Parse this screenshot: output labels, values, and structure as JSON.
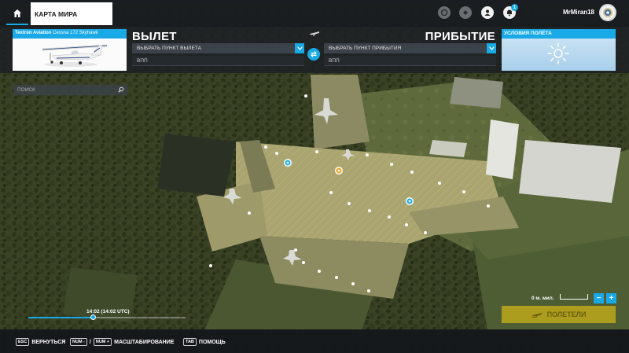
{
  "topbar": {
    "home_tab_label": "КАРТА МИРА",
    "username": "MrMiran18",
    "notification_count": "1"
  },
  "flight": {
    "aircraft_brand": "Textron Aviation",
    "aircraft_model": " Cessna 172 Skyhawk",
    "departure_title": "ВЫЛЕТ",
    "departure_select": "ВЫБРАТЬ ПУНКТ ВЫЛЕТА",
    "departure_runway": "ВПП",
    "arrival_title": "ПРИБЫТИЕ",
    "arrival_select": "ВЫБРАТЬ ПУНКТ ПРИБЫТИЯ",
    "arrival_runway": "ВПП",
    "weather_title": "УСЛОВИЯ ПОЛЁТА"
  },
  "search": {
    "placeholder": "ПОИСК"
  },
  "time": {
    "label": "14:02 (14:02 UTC)",
    "progress": 0.41
  },
  "map": {
    "scale_label": "0 м. мил.",
    "zoom_out": "−",
    "zoom_in": "+"
  },
  "fly_button": {
    "label": "ПОЛЕТЕЛИ"
  },
  "bottom": {
    "back_key": "ESC",
    "back_label": "ВЕРНУТЬСЯ",
    "zoom_key_minus": "NUM -",
    "zoom_sep": "/",
    "zoom_key_plus": "NUM +",
    "zoom_label": "МАСШТАБИРОВАНИЕ",
    "help_key": "TAB",
    "help_label": "ПОМОЩЬ"
  },
  "colors": {
    "accent": "#18a9e6",
    "fly_button": "#c8b018",
    "panel": "#1c2024"
  }
}
